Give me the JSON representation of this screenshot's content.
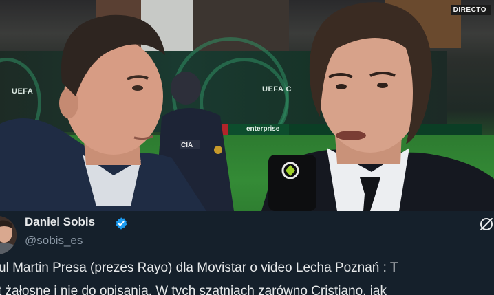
{
  "video": {
    "live_badge": "DIRECTO",
    "hoarding_text_left": "UEFA",
    "hoarding_text_right": "UEFA C",
    "ad_text": "enterprise",
    "vest_text": "CIA"
  },
  "tweet": {
    "author_name": "Daniel Sobis",
    "author_handle": "@sobis_es",
    "verified": true,
    "text_line_1": "ul Martin Presa (prezes Rayo) dla Movistar o video Lecha Poznań : T",
    "text_line_2": "t żałosne i nie do opisania. W tych szatniach zarówno Cristiano, jak"
  },
  "colors": {
    "card_background": "#15202b",
    "name_text": "#e7e9ea",
    "handle_text": "#8b98a5",
    "verified_badge": "#1d9bf0"
  },
  "icons": {
    "verified": "verified-badge-icon",
    "grok": "grok-icon"
  }
}
